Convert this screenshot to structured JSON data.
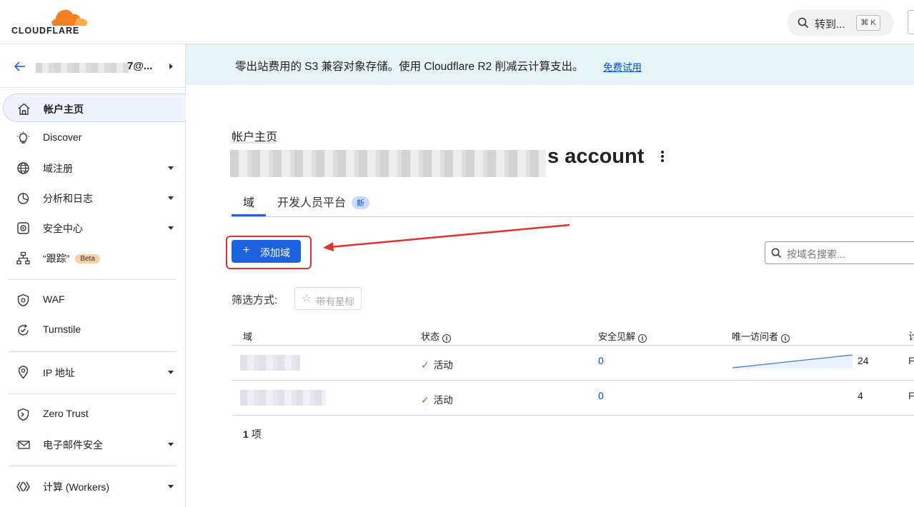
{
  "header": {
    "logo_text": "CLOUDFLARE",
    "goto_label": "转到...",
    "shortcut": "⌘ K"
  },
  "sidebar": {
    "account_name_suffix": "7@...",
    "items": [
      {
        "label": "帐户主页",
        "icon": "home-icon",
        "active": true
      },
      {
        "label": "Discover",
        "icon": "lightbulb-icon"
      },
      {
        "label": "域注册",
        "icon": "globe-icon",
        "dropdown": true
      },
      {
        "label": "分析和日志",
        "icon": "pie-chart-icon",
        "dropdown": true
      },
      {
        "label": "安全中心",
        "icon": "shield-gear-icon",
        "dropdown": true
      },
      {
        "label": "“跟踪”",
        "icon": "network-icon",
        "badge": "Beta"
      },
      {
        "label": "WAF",
        "icon": "waf-shield-icon"
      },
      {
        "label": "Turnstile",
        "icon": "turnstile-icon"
      },
      {
        "label": "IP 地址",
        "icon": "location-pin-icon",
        "dropdown": true
      },
      {
        "label": "Zero Trust",
        "icon": "zero-trust-icon"
      },
      {
        "label": "电子邮件安全",
        "icon": "email-shield-icon",
        "dropdown": true
      },
      {
        "label": "计算 (Workers)",
        "icon": "workers-icon",
        "dropdown": true
      }
    ]
  },
  "banner": {
    "text": "零出站费用的 S3 兼容对象存储。使用 Cloudflare R2 削减云计算支出。",
    "link": "免费试用"
  },
  "page": {
    "breadcrumb": "帐户主页",
    "title_suffix": "s account",
    "tabs": [
      {
        "label": "域",
        "active": true
      },
      {
        "label": "开发人员平台",
        "badge": "新"
      }
    ],
    "add_button": "添加域",
    "search_placeholder": "按域名搜索...",
    "filter_label": "筛选方式:",
    "starred_button": "带有星标",
    "table": {
      "columns": [
        "域",
        "状态",
        "安全见解",
        "唯一访问者"
      ],
      "rows": [
        {
          "status": "活动",
          "insights": "0",
          "visitors": "24",
          "plan": "F"
        },
        {
          "status": "活动",
          "insights": "0",
          "visitors": "4",
          "plan": "F"
        }
      ]
    },
    "count_num": "1",
    "count_unit": "项"
  }
}
